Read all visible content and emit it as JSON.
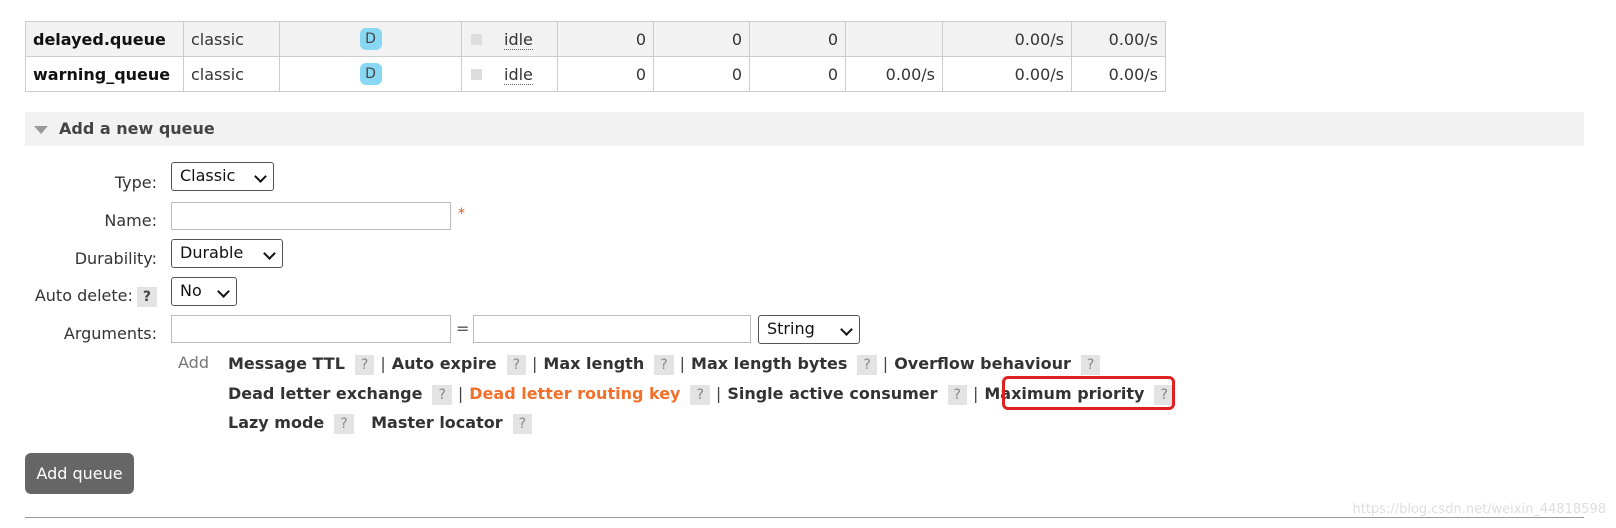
{
  "queues": [
    {
      "name": "delayed.queue",
      "type": "classic",
      "features": "D",
      "state": "idle",
      "ready": "0",
      "unacked": "0",
      "total": "0",
      "incoming": "",
      "deliver": "0.00/s",
      "ack": "0.00/s"
    },
    {
      "name": "warning_queue",
      "type": "classic",
      "features": "D",
      "state": "idle",
      "ready": "0",
      "unacked": "0",
      "total": "0",
      "incoming": "0.00/s",
      "deliver": "0.00/s",
      "ack": "0.00/s"
    }
  ],
  "section": {
    "title": "Add a new queue",
    "icon": "triangle-down-icon"
  },
  "form": {
    "type_label": "Type:",
    "type_value": "Classic",
    "name_label": "Name:",
    "name_value": "",
    "required_mark": "*",
    "durability_label": "Durability:",
    "durability_value": "Durable",
    "auto_delete_label": "Auto delete:",
    "auto_delete_value": "No",
    "arguments_label": "Arguments:",
    "arg_key_value": "",
    "arg_equals": "=",
    "arg_value_value": "",
    "arg_type_value": "String",
    "help": "?"
  },
  "args": {
    "add_label": "Add",
    "message_ttl": "Message TTL",
    "auto_expire": "Auto expire",
    "max_length": "Max length",
    "max_length_bytes": "Max length bytes",
    "overflow_behaviour": "Overflow behaviour",
    "dead_letter_exchange": "Dead letter exchange",
    "dead_letter_routing_key": "Dead letter routing key",
    "single_active_consumer": "Single active consumer",
    "maximum_priority": "Maximum priority",
    "lazy_mode": "Lazy mode",
    "master_locator": "Master locator",
    "separator": "|"
  },
  "button": {
    "add_queue": "Add queue"
  },
  "watermark": "https://blog.csdn.net/weixin_44818598",
  "colors": {
    "accent_orange": "#f3702b",
    "badge_blue": "#88d8f4",
    "highlight_red": "#e02020",
    "button_gray": "#666666"
  }
}
